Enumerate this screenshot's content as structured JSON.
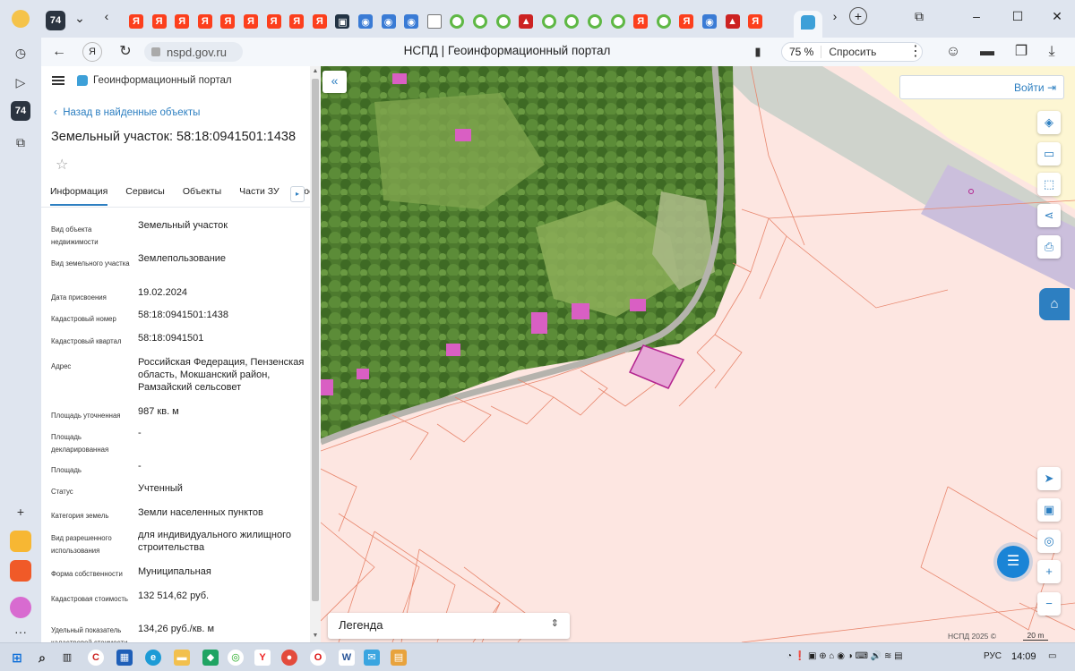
{
  "browser": {
    "tab_badge": "74",
    "url": "nspd.gov.ru",
    "page_title": "НСПД | Геоинформационный портал",
    "zoom": "75 %",
    "ask_label": "Спросить",
    "tab_icons": [
      "ya",
      "ya",
      "ya",
      "ya",
      "ya",
      "ya",
      "ya",
      "ya",
      "ya",
      "dark",
      "blue",
      "blue",
      "blue",
      "doc",
      "green",
      "green",
      "green",
      "red",
      "green",
      "green",
      "green",
      "green",
      "ya",
      "green",
      "ya",
      "blue",
      "red",
      "ya"
    ]
  },
  "panel": {
    "portal_name": "Геоинформационный портал",
    "back_link": "Назад в найденные объекты",
    "title": "Земельный участок: 58:18:0941501:1438",
    "tabs": [
      "Информация",
      "Сервисы",
      "Объекты",
      "Части ЗУ",
      "Сост"
    ],
    "fields": [
      {
        "label": "Вид объекта недвижимости",
        "value": "Земельный участок"
      },
      {
        "label": "Вид земельного участка",
        "value": "Землепользование"
      },
      {
        "label": "Дата присвоения",
        "value": "19.02.2024"
      },
      {
        "label": "Кадастровый номер",
        "value": "58:18:0941501:1438"
      },
      {
        "label": "Кадастровый квартал",
        "value": "58:18:0941501"
      },
      {
        "label": "Адрес",
        "value": "Российская Федерация, Пензенская область, Мокшанский район, Рамзайский сельсовет"
      },
      {
        "label": "Площадь уточненная",
        "value": "987 кв. м"
      },
      {
        "label": "Площадь декларированная",
        "value": "-"
      },
      {
        "label": "Площадь",
        "value": "-"
      },
      {
        "label": "Статус",
        "value": "Учтенный"
      },
      {
        "label": "Категория земель",
        "value": "Земли населенных пунктов"
      },
      {
        "label": "Вид разрешенного использования",
        "value": "для индивидуального жилищного строительства"
      },
      {
        "label": "Форма собственности",
        "value": "Муниципальная"
      },
      {
        "label": "Кадастровая стоимость",
        "value": "132 514,62 руб."
      },
      {
        "label": "Удельный показатель кадастровой стоимости",
        "value": "134,26 руб./кв. м"
      }
    ]
  },
  "map": {
    "login_label": "Войти",
    "legend_label": "Легенда",
    "attribution": "НСПД 2025 ©",
    "scale_label": "20 m",
    "colors": {
      "parcel_fill": "#fde6e1",
      "parcel_line": "#e8876e",
      "selected_fill": "#e7a8d7",
      "selected_line": "#b3248f",
      "accent": "#2d7fc1"
    }
  },
  "taskbar": {
    "lang": "РУС",
    "time": "14:09"
  }
}
